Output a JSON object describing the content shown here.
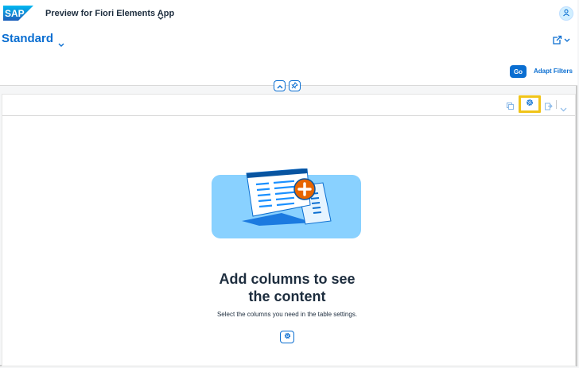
{
  "shell": {
    "logo_text": "SAP",
    "app_title": "Preview for Fiori Elements App"
  },
  "header": {
    "variant_title": "Standard",
    "go_label": "Go",
    "adapt_filters_label": "Adapt Filters"
  },
  "empty_state": {
    "title_line1": "Add columns to see",
    "title_line2": "the content",
    "description": "Select the columns you need in the table settings."
  },
  "icons": {
    "title_chevron": "chevron-down-icon",
    "avatar": "user-icon",
    "variant_chevron": "chevron-down-icon",
    "share": "share-icon",
    "collapse": "chevron-up-icon",
    "pin": "pin-icon",
    "copy": "copy-icon",
    "settings": "gear-icon",
    "export": "export-icon",
    "export_menu": "chevron-down-icon"
  },
  "colors": {
    "accent": "#0a6ed1",
    "highlight": "#f0c419",
    "illustration_bg": "#89d1ff",
    "illustration_plus": "#e76500"
  }
}
